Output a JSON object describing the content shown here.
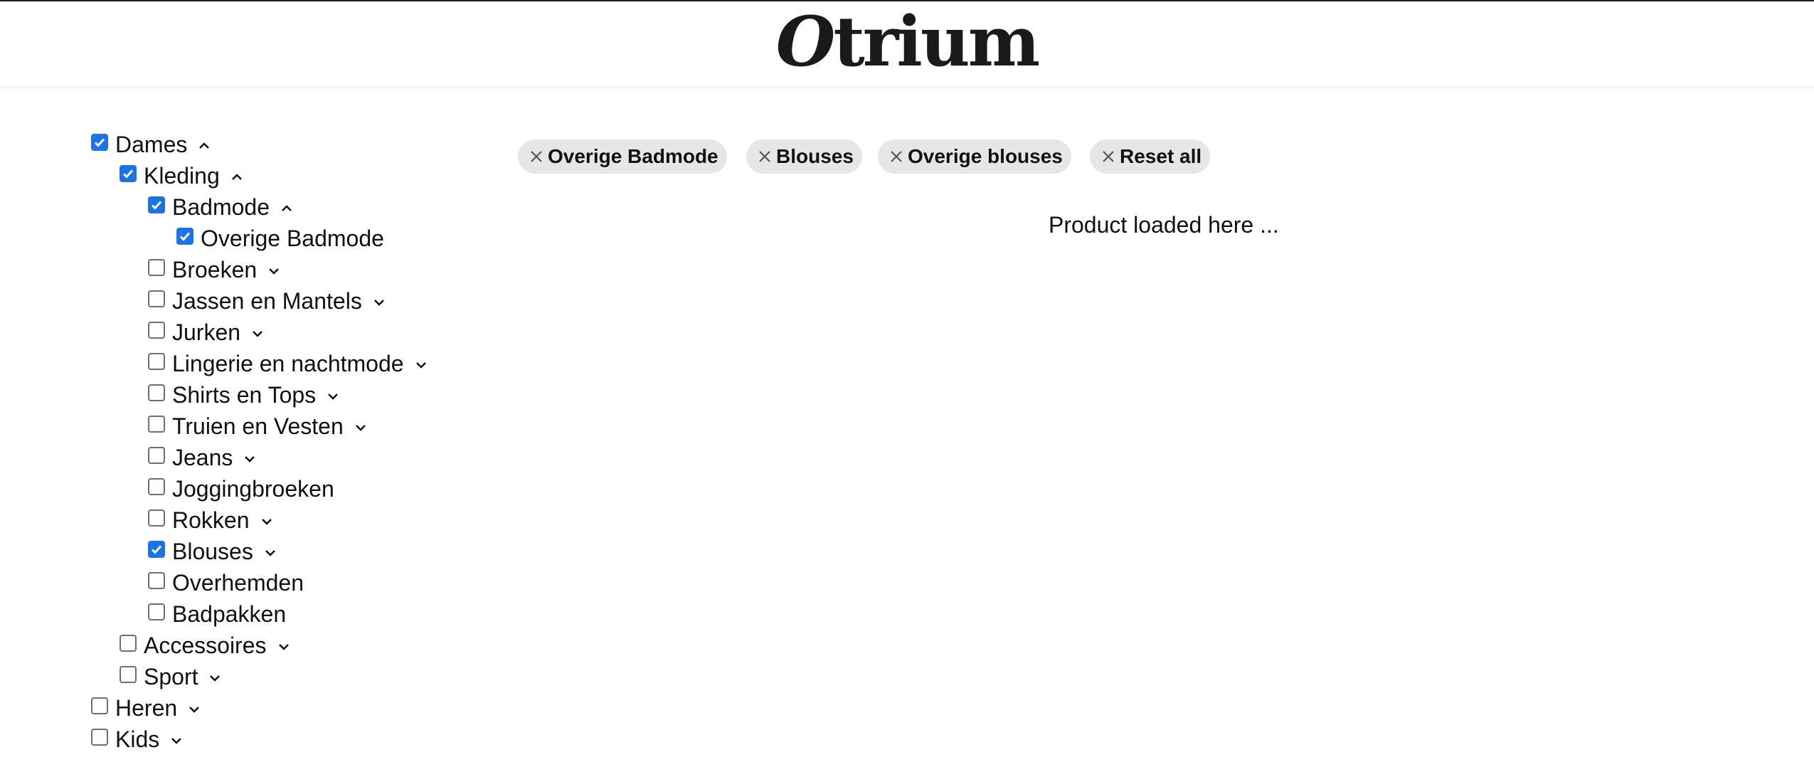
{
  "brand": {
    "logo_first": "O",
    "logo_rest": "trium"
  },
  "filters": {
    "chips": [
      {
        "label": "Overige Badmode"
      },
      {
        "label": "Blouses"
      },
      {
        "label": "Overige blouses"
      },
      {
        "label": "Reset all"
      }
    ]
  },
  "tree": {
    "dames": "Dames",
    "kleding": "Kleding",
    "badmode": "Badmode",
    "overige_badmode": "Overige Badmode",
    "broeken": "Broeken",
    "jassen": "Jassen en Mantels",
    "jurken": "Jurken",
    "lingerie": "Lingerie en nachtmode",
    "shirts": "Shirts en Tops",
    "truien": "Truien en Vesten",
    "jeans": "Jeans",
    "joggingbroeken": "Joggingbroeken",
    "rokken": "Rokken",
    "blouses": "Blouses",
    "overhemden": "Overhemden",
    "badpakken": "Badpakken",
    "accessoires": "Accessoires",
    "sport": "Sport",
    "heren": "Heren",
    "kids": "Kids"
  },
  "tree_state": {
    "checked": [
      "dames",
      "kleding",
      "badmode",
      "overige_badmode",
      "blouses"
    ],
    "expanded": [
      "dames",
      "kleding",
      "badmode"
    ]
  },
  "main": {
    "loading_text": "Product loaded here ..."
  },
  "colors": {
    "checkbox_checked": "#1a73e8",
    "chip_bg": "#e6e6e6"
  }
}
